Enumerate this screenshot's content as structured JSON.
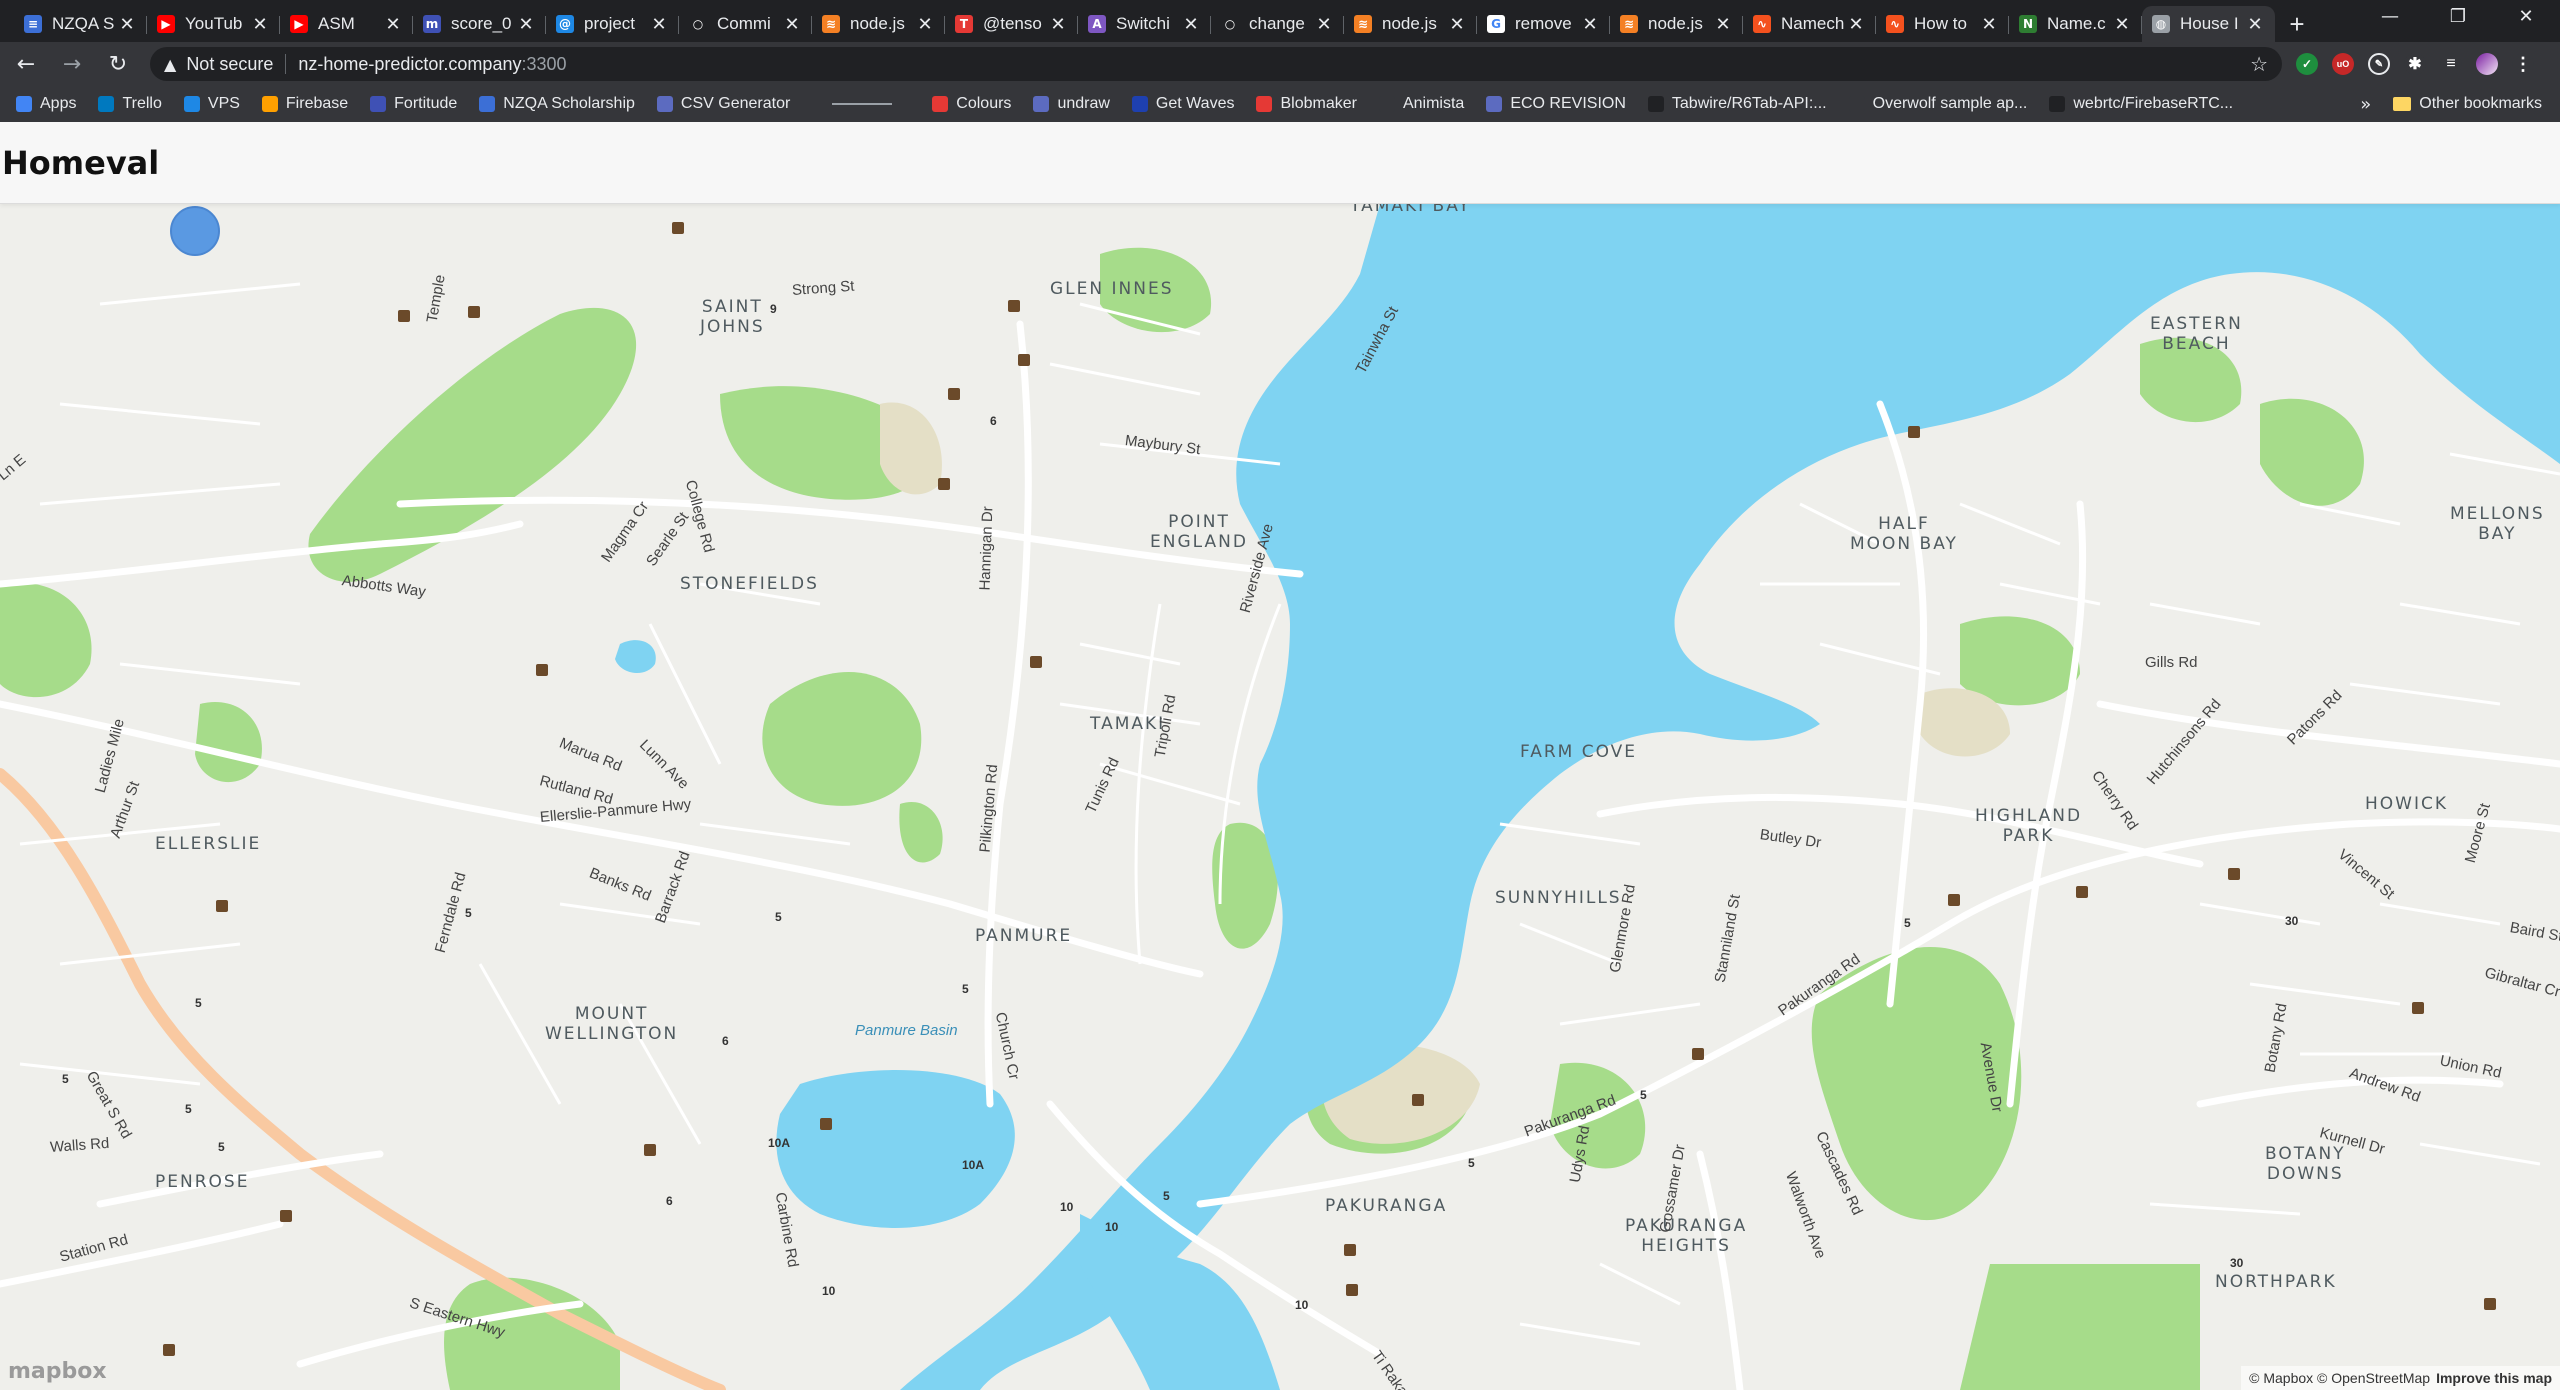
{
  "browser": {
    "tabs": [
      {
        "title": "NZQA S",
        "color": "#3c6fd6",
        "glyph": "≡"
      },
      {
        "title": "YouTub",
        "color": "#ff0000",
        "glyph": "▶"
      },
      {
        "title": "ASM",
        "color": "#ff0000",
        "glyph": "▶"
      },
      {
        "title": "score_0",
        "color": "#3f51b5",
        "glyph": "m"
      },
      {
        "title": "project",
        "color": "#1e88e5",
        "glyph": "@"
      },
      {
        "title": "Commi",
        "color": "#202124",
        "glyph": "○"
      },
      {
        "title": "node.js",
        "color": "#f48024",
        "glyph": "≋"
      },
      {
        "title": "@tenso",
        "color": "#e53935",
        "glyph": "T"
      },
      {
        "title": "Switchi",
        "color": "#7e57c2",
        "glyph": "A"
      },
      {
        "title": "change",
        "color": "#202124",
        "glyph": "○"
      },
      {
        "title": "node.js",
        "color": "#f48024",
        "glyph": "≋"
      },
      {
        "title": "remove",
        "color": "#ffffff",
        "glyph": "G"
      },
      {
        "title": "node.js",
        "color": "#f48024",
        "glyph": "≋"
      },
      {
        "title": "Namech",
        "color": "#f4511e",
        "glyph": "∿"
      },
      {
        "title": "How to",
        "color": "#f4511e",
        "glyph": "∿"
      },
      {
        "title": "Name.c",
        "color": "#2e7d32",
        "glyph": "N"
      },
      {
        "title": "House I",
        "color": "#9aa0a6",
        "glyph": "◍",
        "active": true
      }
    ],
    "address": {
      "security": "Not secure",
      "host": "nz-home-predictor.company",
      "port": ":3300"
    },
    "bookmarks": [
      {
        "label": "Apps",
        "color": "#4285f4"
      },
      {
        "label": "Trello",
        "color": "#0079bf"
      },
      {
        "label": "VPS",
        "color": "#1e88e5"
      },
      {
        "label": "Firebase",
        "color": "#ffa000"
      },
      {
        "label": "Fortitude",
        "color": "#3f51b5"
      },
      {
        "label": "NZQA Scholarship",
        "color": "#3c6fd6"
      },
      {
        "label": "CSV Generator",
        "color": "#5c6bc0"
      }
    ],
    "bookmarks2": [
      {
        "label": "Colours",
        "color": "#e53935"
      },
      {
        "label": "undraw",
        "color": "#5c6bc0"
      },
      {
        "label": "Get Waves",
        "color": "#1e40af"
      },
      {
        "label": "Blobmaker",
        "color": "#e53935"
      },
      {
        "label": "Animista",
        "color": "#35363a"
      },
      {
        "label": "ECO REVISION",
        "color": "#5c6bc0"
      },
      {
        "label": "Tabwire/R6Tab-API:...",
        "color": "#202124"
      },
      {
        "label": "Overwolf sample ap...",
        "color": "#35363a"
      },
      {
        "label": "webrtc/FirebaseRTC...",
        "color": "#202124"
      }
    ],
    "bookmarks_more": "»",
    "other_bookmarks": "Other bookmarks"
  },
  "app": {
    "brand": "Homeval"
  },
  "map": {
    "attribution": "© Mapbox © OpenStreetMap",
    "improve": "Improve this map",
    "logo": "mapbox",
    "water_label": "Panmure Basin",
    "colors": {
      "water": "#7fd3f2",
      "land": "#efefeb",
      "park": "#a6dc8a",
      "road": "#ffffff",
      "highway": "#f9c9a1",
      "location": "#4a90e2"
    },
    "suburbs": [
      {
        "name": "SAINT\nJOHNS"
      },
      {
        "name": "GLEN INNES"
      },
      {
        "name": "TAMAKI BAY"
      },
      {
        "name": "EASTERN\nBEACH"
      },
      {
        "name": "POINT\nENGLAND"
      },
      {
        "name": "HALF\nMOON BAY"
      },
      {
        "name": "MELLONS\nBAY"
      },
      {
        "name": "STONEFIELDS"
      },
      {
        "name": "TAMAKI"
      },
      {
        "name": "FARM COVE"
      },
      {
        "name": "HIGHLAND\nPARK"
      },
      {
        "name": "HOWICK"
      },
      {
        "name": "ELLERSLIE"
      },
      {
        "name": "SUNNYHILLS"
      },
      {
        "name": "PANMURE"
      },
      {
        "name": "MOUNT\nWELLINGTON"
      },
      {
        "name": "BOTANY\nDOWNS"
      },
      {
        "name": "PENROSE"
      },
      {
        "name": "PAKURANGA"
      },
      {
        "name": "PAKURANGA\nHEIGHTS"
      },
      {
        "name": "NORTHPARK"
      }
    ],
    "roads": [
      {
        "name": "Strong St"
      },
      {
        "name": "Temple"
      },
      {
        "name": "Tainwha St"
      },
      {
        "name": "Maybury St"
      },
      {
        "name": "College Rd"
      },
      {
        "name": "Magma Cr"
      },
      {
        "name": "Searle St"
      },
      {
        "name": "Hannigan Dr"
      },
      {
        "name": "Riverside Ave"
      },
      {
        "name": "Abbotts Way"
      },
      {
        "name": "Gills Rd"
      },
      {
        "name": "Marua Rd"
      },
      {
        "name": "Lunn Ave"
      },
      {
        "name": "Rutland Rd"
      },
      {
        "name": "Tripoli Rd"
      },
      {
        "name": "Tunis Rd"
      },
      {
        "name": "Ladies Mile"
      },
      {
        "name": "Arthur St"
      },
      {
        "name": "Ellerslie-Panmure Hwy"
      },
      {
        "name": "Pilkington Rd"
      },
      {
        "name": "Butley Dr"
      },
      {
        "name": "Cherry Rd"
      },
      {
        "name": "Hutchinsons Rd"
      },
      {
        "name": "Patons Rd"
      },
      {
        "name": "Banks Rd"
      },
      {
        "name": "Barrack Rd"
      },
      {
        "name": "Ferndale Rd"
      },
      {
        "name": "Church Cr"
      },
      {
        "name": "Glenmore Rd"
      },
      {
        "name": "Stanniland St"
      },
      {
        "name": "Pakuranga Rd"
      },
      {
        "name": "Vincent St"
      },
      {
        "name": "Baird St"
      },
      {
        "name": "Gibraltar Cr"
      },
      {
        "name": "Moore St"
      },
      {
        "name": "Avenue Dr"
      },
      {
        "name": "Union Rd"
      },
      {
        "name": "Botany Rd"
      },
      {
        "name": "Andrew Rd"
      },
      {
        "name": "Kurnell Dr"
      },
      {
        "name": "Great S Rd"
      },
      {
        "name": "Walls Rd"
      },
      {
        "name": "Station Rd"
      },
      {
        "name": "S Eastern Hwy"
      },
      {
        "name": "Carbine Rd"
      },
      {
        "name": "Cascades Rd"
      },
      {
        "name": "Walworth Ave"
      },
      {
        "name": "Udys Rd"
      },
      {
        "name": "Gossamer Dr"
      },
      {
        "name": "Ti Rakau Dr"
      },
      {
        "name": "Ln E"
      },
      {
        "name": "Pakuranga Rd"
      }
    ],
    "route_numbers": [
      "9",
      "6",
      "5",
      "5",
      "5",
      "5",
      "5",
      "5",
      "5",
      "5",
      "5",
      "6",
      "6",
      "10A",
      "10A",
      "10",
      "10",
      "10",
      "10",
      "30",
      "30",
      "5",
      "5"
    ]
  }
}
